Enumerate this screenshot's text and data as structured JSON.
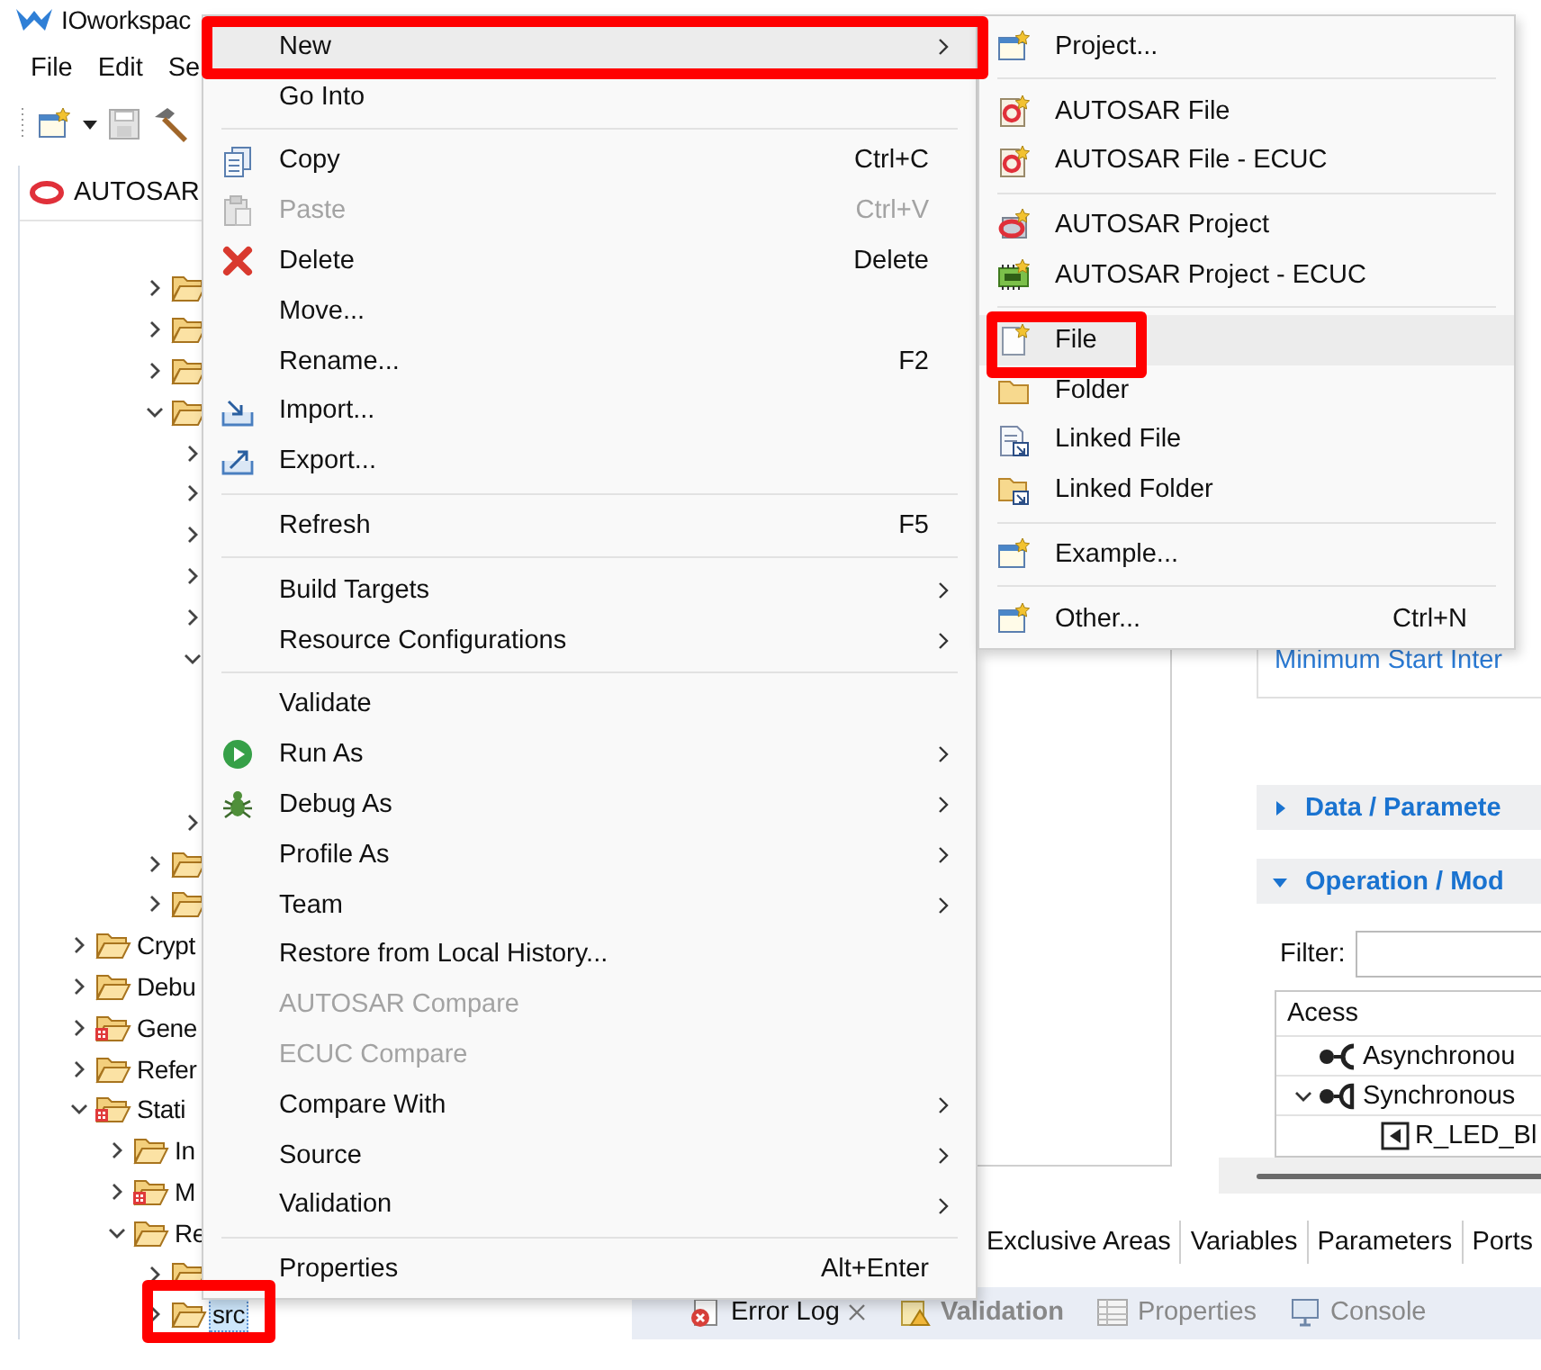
{
  "window": {
    "title": "IOworkspac"
  },
  "menubar": [
    "File",
    "Edit",
    "Se"
  ],
  "explorer": {
    "tab": "AUTOSAR",
    "tree_top": [
      {
        "expanded": false
      },
      {
        "expanded": false
      },
      {
        "expanded": false
      },
      {
        "expanded": true,
        "children": [
          {
            "expanded": false
          },
          {
            "expanded": false
          },
          {
            "expanded": false
          },
          {
            "expanded": false
          },
          {
            "expanded": false
          },
          {
            "expanded": true
          },
          {
            "expanded": false
          }
        ]
      },
      {
        "expanded": false
      },
      {
        "expanded": false
      }
    ],
    "tree": [
      {
        "label": "Crypt",
        "expanded": false,
        "error": false,
        "selected": false,
        "highlighted": false
      },
      {
        "label": "Debu",
        "expanded": false,
        "error": false,
        "selected": false,
        "highlighted": false
      },
      {
        "label": "Gene",
        "expanded": false,
        "error": true,
        "selected": false,
        "highlighted": false
      },
      {
        "label": "Refer",
        "expanded": false,
        "error": false,
        "selected": false,
        "highlighted": false
      },
      {
        "label": "Stati",
        "expanded": true,
        "error": true,
        "selected": false,
        "highlighted": false,
        "children": [
          {
            "label": "In",
            "expanded": false,
            "error": false,
            "selected": false,
            "highlighted": false
          },
          {
            "label": "M",
            "expanded": false,
            "error": true,
            "selected": false,
            "highlighted": false
          },
          {
            "label": "Re",
            "expanded": true,
            "error": false,
            "selected": false,
            "highlighted": false,
            "children": [
              {
                "expanded": false,
                "error": false
              },
              {
                "label": "src",
                "expanded": false,
                "error": false,
                "selected": true,
                "highlighted": true
              }
            ]
          }
        ]
      }
    ]
  },
  "context_menu": {
    "groups": [
      [
        {
          "label": "New",
          "submenu": true,
          "disabled": false,
          "selected": true,
          "highlighted": true
        },
        {
          "label": "Go Into",
          "submenu": false,
          "disabled": false,
          "selected": false,
          "highlighted": false
        }
      ],
      [
        {
          "label": "Copy",
          "shortcut": "Ctrl+C",
          "submenu": false,
          "disabled": false,
          "selected": false,
          "highlighted": false
        },
        {
          "label": "Paste",
          "shortcut": "Ctrl+V",
          "submenu": false,
          "disabled": true,
          "selected": false,
          "highlighted": false
        },
        {
          "label": "Delete",
          "shortcut": "Delete",
          "submenu": false,
          "disabled": false,
          "selected": false,
          "highlighted": false
        },
        {
          "label": "Move...",
          "submenu": false,
          "disabled": false,
          "selected": false,
          "highlighted": false
        },
        {
          "label": "Rename...",
          "shortcut": "F2",
          "submenu": false,
          "disabled": false,
          "selected": false,
          "highlighted": false
        },
        {
          "label": "Import...",
          "submenu": false,
          "disabled": false,
          "selected": false,
          "highlighted": false
        },
        {
          "label": "Export...",
          "submenu": false,
          "disabled": false,
          "selected": false,
          "highlighted": false
        }
      ],
      [
        {
          "label": "Refresh",
          "shortcut": "F5",
          "submenu": false,
          "disabled": false,
          "selected": false,
          "highlighted": false
        }
      ],
      [
        {
          "label": "Build Targets",
          "submenu": true,
          "disabled": false,
          "selected": false,
          "highlighted": false
        },
        {
          "label": "Resource Configurations",
          "submenu": true,
          "disabled": false,
          "selected": false,
          "highlighted": false
        }
      ],
      [
        {
          "label": "Validate",
          "submenu": false,
          "disabled": false,
          "selected": false,
          "highlighted": false
        },
        {
          "label": "Run As",
          "submenu": true,
          "disabled": false,
          "selected": false,
          "highlighted": false
        },
        {
          "label": "Debug As",
          "submenu": true,
          "disabled": false,
          "selected": false,
          "highlighted": false
        },
        {
          "label": "Profile As",
          "submenu": true,
          "disabled": false,
          "selected": false,
          "highlighted": false
        },
        {
          "label": "Team",
          "submenu": true,
          "disabled": false,
          "selected": false,
          "highlighted": false
        },
        {
          "label": "Restore from Local History...",
          "submenu": false,
          "disabled": false,
          "selected": false,
          "highlighted": false
        },
        {
          "label": "AUTOSAR Compare",
          "submenu": false,
          "disabled": true,
          "selected": false,
          "highlighted": false
        },
        {
          "label": "ECUC Compare",
          "submenu": false,
          "disabled": true,
          "selected": false,
          "highlighted": false
        },
        {
          "label": "Compare With",
          "submenu": true,
          "disabled": false,
          "selected": false,
          "highlighted": false
        },
        {
          "label": "Source",
          "submenu": true,
          "disabled": false,
          "selected": false,
          "highlighted": false
        },
        {
          "label": "Validation",
          "submenu": true,
          "disabled": false,
          "selected": false,
          "highlighted": false
        }
      ],
      [
        {
          "label": "Properties",
          "shortcut": "Alt+Enter",
          "submenu": false,
          "disabled": false,
          "selected": false,
          "highlighted": false
        }
      ]
    ]
  },
  "new_submenu": {
    "groups": [
      [
        {
          "label": "Project...",
          "selected": false,
          "highlighted": false
        }
      ],
      [
        {
          "label": "AUTOSAR File",
          "selected": false,
          "highlighted": false
        },
        {
          "label": "AUTOSAR File - ECUC",
          "selected": false,
          "highlighted": false
        }
      ],
      [
        {
          "label": "AUTOSAR Project",
          "selected": false,
          "highlighted": false
        },
        {
          "label": "AUTOSAR Project - ECUC",
          "selected": false,
          "highlighted": false
        }
      ],
      [
        {
          "label": "File",
          "selected": true,
          "highlighted": true
        },
        {
          "label": "Folder",
          "selected": false,
          "highlighted": false
        },
        {
          "label": "Linked File",
          "selected": false,
          "highlighted": false
        },
        {
          "label": "Linked Folder",
          "selected": false,
          "highlighted": false
        }
      ],
      [
        {
          "label": "Example...",
          "selected": false,
          "highlighted": false
        }
      ],
      [
        {
          "label": "Other...",
          "shortcut": "Ctrl+N",
          "selected": false,
          "highlighted": false
        }
      ]
    ]
  },
  "editor": {
    "field_label": "Minimum Start Inter",
    "sections": [
      {
        "title": "Data / Paramete",
        "expanded": false
      },
      {
        "title": "Operation / Mod",
        "expanded": true
      }
    ],
    "filter": {
      "label": "Filter:"
    },
    "access_table": {
      "header": "Acess",
      "rows": [
        {
          "label": "Asynchronou"
        },
        {
          "label": "Synchronous",
          "expanded": true,
          "children": [
            {
              "label": "R_LED_Bl"
            }
          ]
        }
      ]
    },
    "tabs": [
      "Exclusive Areas",
      "Variables",
      "Parameters",
      "Ports"
    ]
  },
  "bottom_panel": {
    "tabs": [
      {
        "label": "Error Log",
        "selected": true,
        "closable": true,
        "bold": false
      },
      {
        "label": "Validation",
        "selected": false,
        "closable": false,
        "bold": true
      },
      {
        "label": "Properties",
        "selected": false,
        "closable": false,
        "bold": false
      },
      {
        "label": "Console",
        "selected": false,
        "closable": false,
        "bold": false
      }
    ]
  }
}
